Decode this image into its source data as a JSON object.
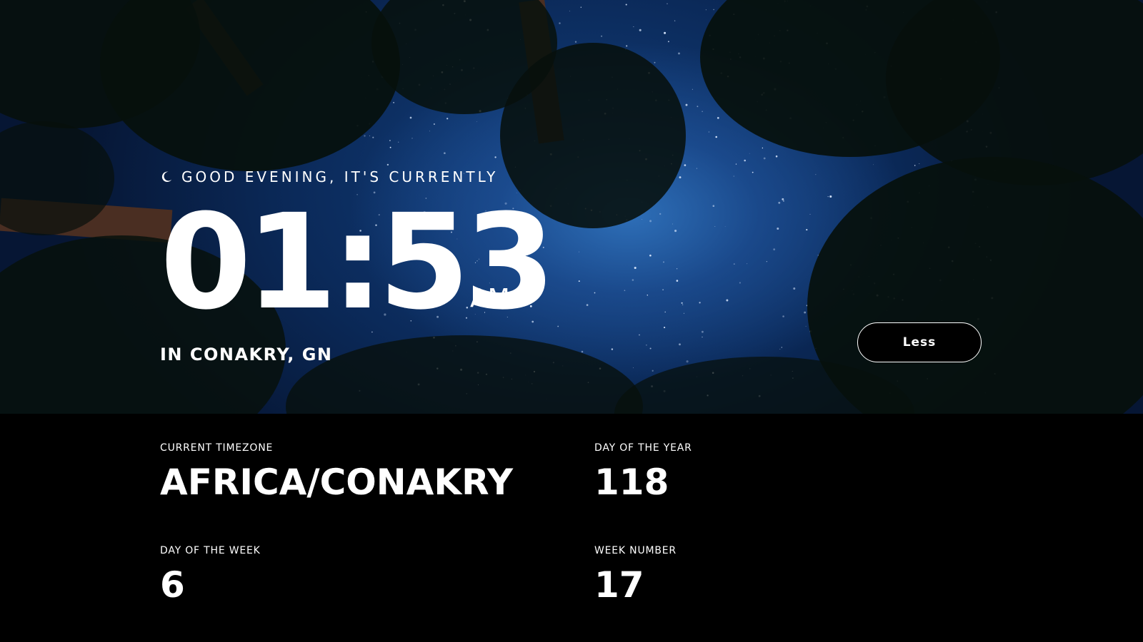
{
  "greeting": {
    "icon": "moon-icon",
    "text": "GOOD EVENING, IT'S CURRENTLY"
  },
  "clock": {
    "time": "01:53",
    "period": "AM",
    "location": "IN CONAKRY, GN"
  },
  "toggle_button": {
    "label": "Less"
  },
  "details": {
    "timezone": {
      "label": "CURRENT TIMEZONE",
      "value": "AFRICA/CONAKRY"
    },
    "day_of_year": {
      "label": "DAY OF THE YEAR",
      "value": "118"
    },
    "day_of_week": {
      "label": "DAY OF THE WEEK",
      "value": "6"
    },
    "week_number": {
      "label": "WEEK NUMBER",
      "value": "17"
    }
  },
  "colors": {
    "sky": "#0b2a5a",
    "panel_background": "#000000",
    "text": "#ffffff"
  }
}
